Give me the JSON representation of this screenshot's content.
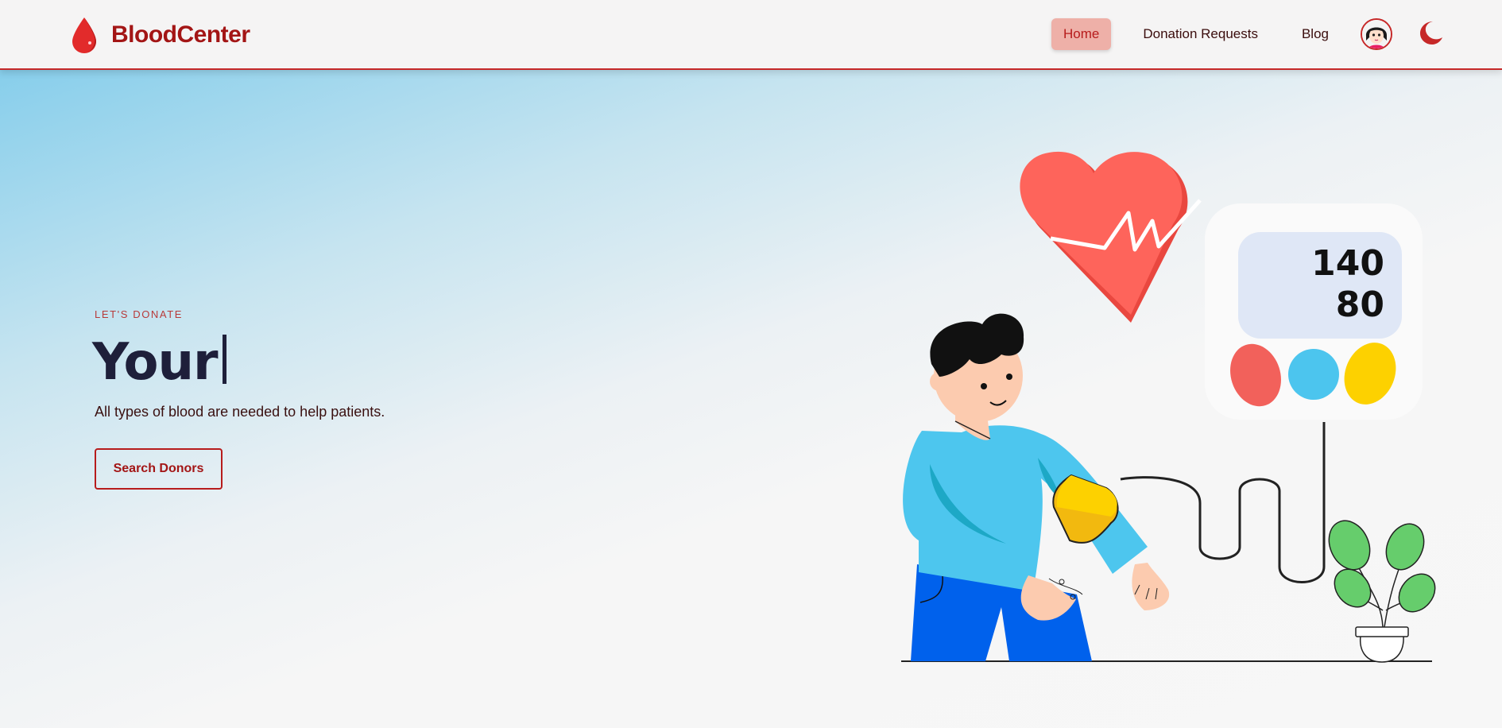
{
  "navbar": {
    "brand": "BloodCenter",
    "links": [
      {
        "label": "Home",
        "active": true
      },
      {
        "label": "Donation Requests",
        "active": false
      },
      {
        "label": "Blog",
        "active": false
      }
    ]
  },
  "hero": {
    "eyebrow": "LET'S DONATE",
    "headline": "Your",
    "subtitle": "All types of blood are needed to help patients.",
    "cta": "Search Donors"
  },
  "monitor": {
    "systolic": "140",
    "diastolic": "80"
  },
  "colors": {
    "brand": "#a31515",
    "accent": "#c62828",
    "active_nav": "#eeb0a8",
    "heading": "#1e1f3a"
  },
  "icons": {
    "brand": "blood-drop-icon",
    "theme": "moon-icon",
    "user": "avatar"
  }
}
